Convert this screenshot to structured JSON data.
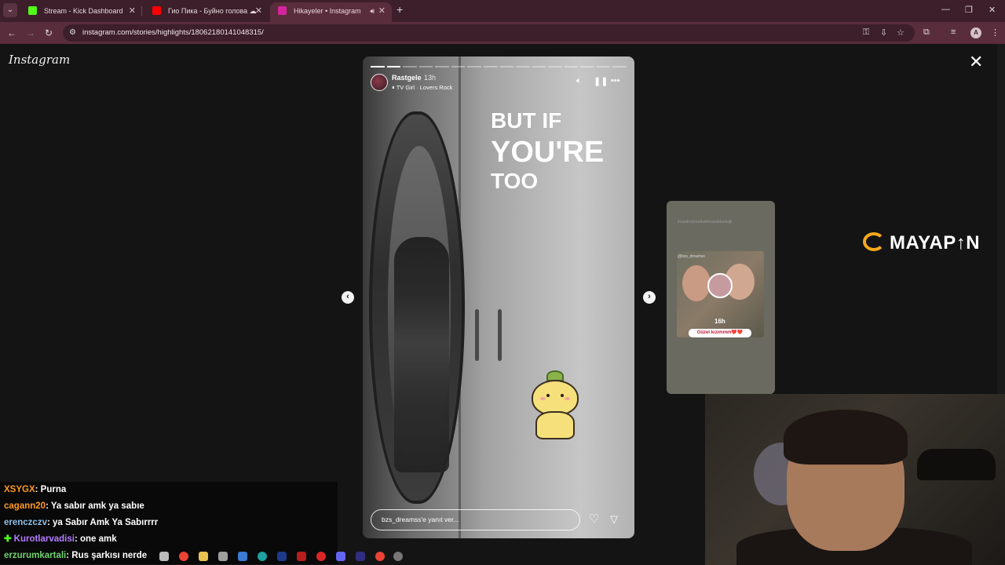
{
  "browser": {
    "tabs": [
      {
        "label": "Stream - Kick Dashboard",
        "favicon": "kick-icon",
        "color": "#53fc18"
      },
      {
        "label": "Гио Пика - Буйно голова ☁",
        "favicon": "youtube-icon",
        "color": "#ff0000"
      },
      {
        "label": "Hikayeler • Instagram",
        "favicon": "instagram-icon",
        "color": "#d6249f"
      }
    ],
    "url": "instagram.com/stories/highlights/18062180141048315/"
  },
  "instagram": {
    "logo": "Instagram",
    "story": {
      "username": "Rastgele",
      "time": "13h",
      "music": "TV Girl · Lovers Rock",
      "music_prefix": "⏸",
      "quote": [
        "BUT IF",
        "YOU'RE",
        "TOO"
      ],
      "reply_placeholder": "bzs_dreamss'e yanıt ver...",
      "progress_total": 16,
      "progress_done": 2
    },
    "next_preview": {
      "time": "16h",
      "label": "Güzel kızımmm❤️❤️",
      "top_text": "itsaudreykoodudelcasablankajk",
      "tag": "@bzs_dreamss"
    }
  },
  "overlay": {
    "brand": "MAYAP↑N",
    "chat": [
      {
        "user": "XSYGX",
        "color": "#ff9a1f",
        "message": ": Purna"
      },
      {
        "user": "cagann20",
        "color": "#ff9a1f",
        "message": ": Ya sabır amk ya sabıe"
      },
      {
        "user": "erenczczv",
        "color": "#8fbfe8",
        "message": ": ya Sabır Amk Ya Sabırrrr"
      },
      {
        "user": "Kurotlarvadisi",
        "color": "#b57cff",
        "message": ": one amk",
        "badge": "✚"
      },
      {
        "user": "erzurumkartali",
        "color": "#6fd36f",
        "message": ": Rus şarkısı nerde"
      }
    ]
  }
}
